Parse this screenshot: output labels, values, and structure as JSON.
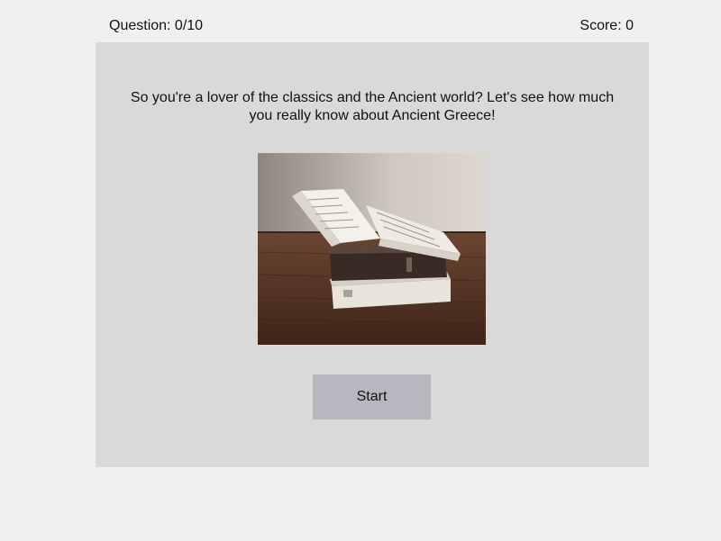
{
  "header": {
    "question_counter": "Question: 0/10",
    "score": "Score: 0"
  },
  "intro": {
    "text": "So you're a lover of the classics and the Ancient world? Let's see how much you really know about Ancient Greece!"
  },
  "image": {
    "subject": "books-stack-photo"
  },
  "actions": {
    "start_label": "Start"
  },
  "colors": {
    "page_bg": "#f0f0ee",
    "panel_bg": "#d9d9d9",
    "button_bg": "#b9b6c0"
  }
}
